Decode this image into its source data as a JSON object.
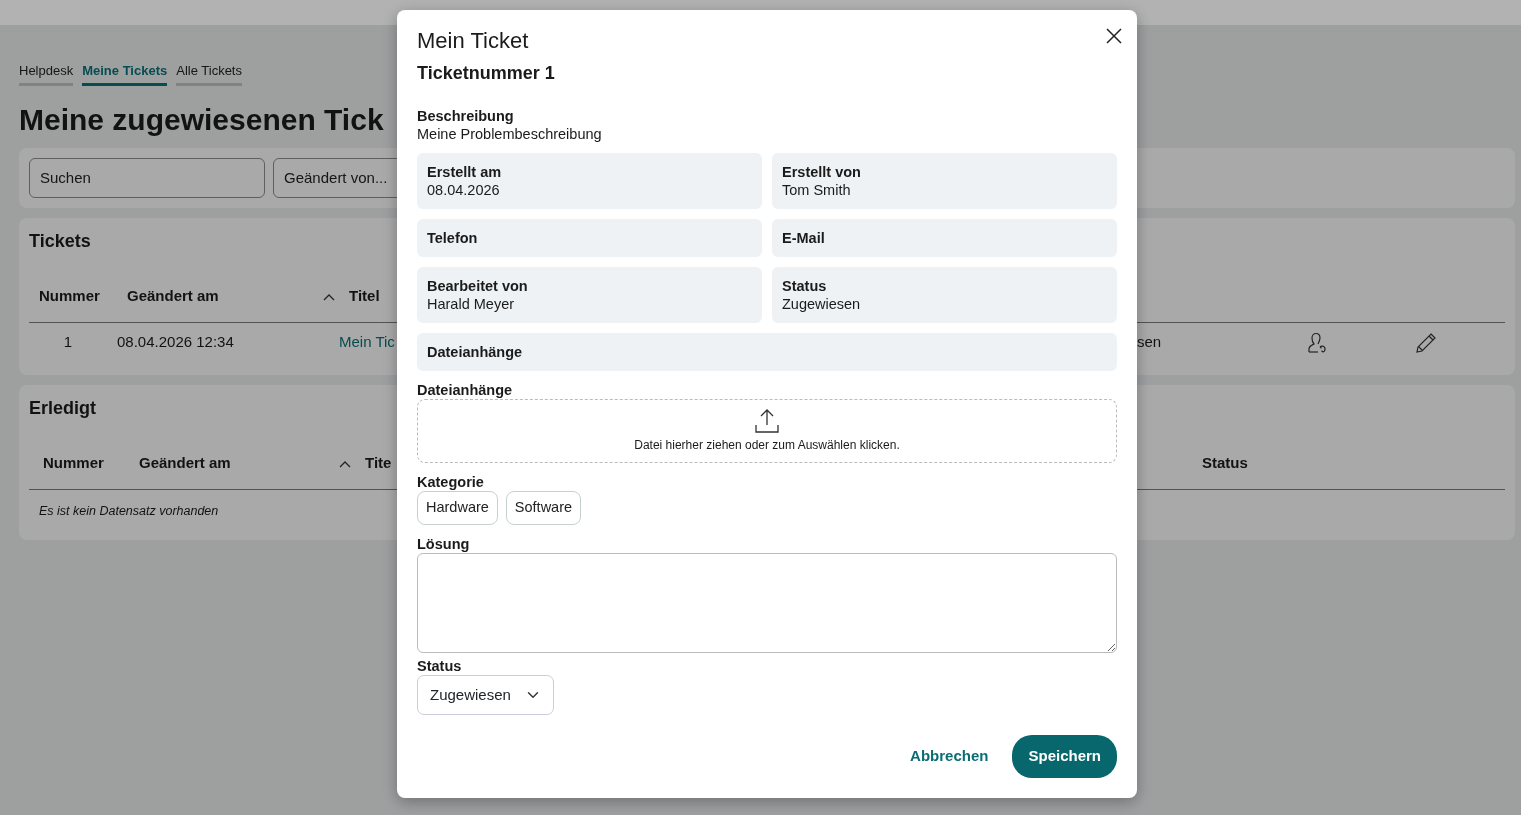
{
  "page": {
    "tabs": [
      {
        "label": "Helpdesk",
        "selected": false
      },
      {
        "label": "Meine Tickets",
        "selected": true
      },
      {
        "label": "Alle Tickets",
        "selected": false
      }
    ],
    "title": "Meine zugewiesenen Tick",
    "filters": [
      {
        "placeholder": "Suchen"
      },
      {
        "placeholder": "Geändert von..."
      }
    ]
  },
  "tickets": {
    "title": "Tickets",
    "columns": [
      {
        "label": "Nummer",
        "sorted": false
      },
      {
        "label": "Geändert am",
        "sorted": true
      },
      {
        "label": "Titel",
        "sorted": false
      }
    ],
    "rows": [
      {
        "number": "1",
        "changed": "08.04.2026 12:34",
        "title": "Mein Tic",
        "status": "sen"
      }
    ]
  },
  "done": {
    "title": "Erledigt",
    "columns": [
      {
        "label": "Nummer",
        "sorted": false
      },
      {
        "label": "Geändert am",
        "sorted": true
      },
      {
        "label": "Tite",
        "sorted": false
      },
      {
        "label": "Status",
        "sorted": false
      }
    ],
    "empty": "Es ist kein Datensatz vorhanden"
  },
  "modal": {
    "title": "Mein Ticket",
    "subtitle": "Ticketnummer 1",
    "description": {
      "label": "Beschreibung",
      "value": "Meine Problembeschreibung"
    },
    "fields": [
      {
        "label": "Erstellt am",
        "value": "08.04.2026",
        "wide": false
      },
      {
        "label": "Erstellt von",
        "value": "Tom Smith",
        "wide": false
      },
      {
        "label": "Telefon",
        "wide": false
      },
      {
        "label": "E-Mail",
        "wide": false
      },
      {
        "label": "Bearbeitet von",
        "value": "Harald Meyer",
        "wide": false
      },
      {
        "label": "Status",
        "value": "Zugewiesen",
        "wide": false
      },
      {
        "label": "Dateianhänge",
        "wide": true
      }
    ],
    "attachments": {
      "label": "Dateianhänge",
      "hint": "Datei hierher ziehen oder zum Auswählen klicken."
    },
    "category": {
      "label": "Kategorie",
      "options": [
        {
          "label": "Hardware",
          "selected": false
        },
        {
          "label": "Software",
          "selected": false
        }
      ]
    },
    "solution": {
      "label": "Lösung"
    },
    "status": {
      "label": "Status",
      "value": "Zugewiesen"
    },
    "buttons": [
      {
        "label": "Abbrechen",
        "kind": "link"
      },
      {
        "label": "Speichern",
        "kind": "primary"
      }
    ]
  }
}
